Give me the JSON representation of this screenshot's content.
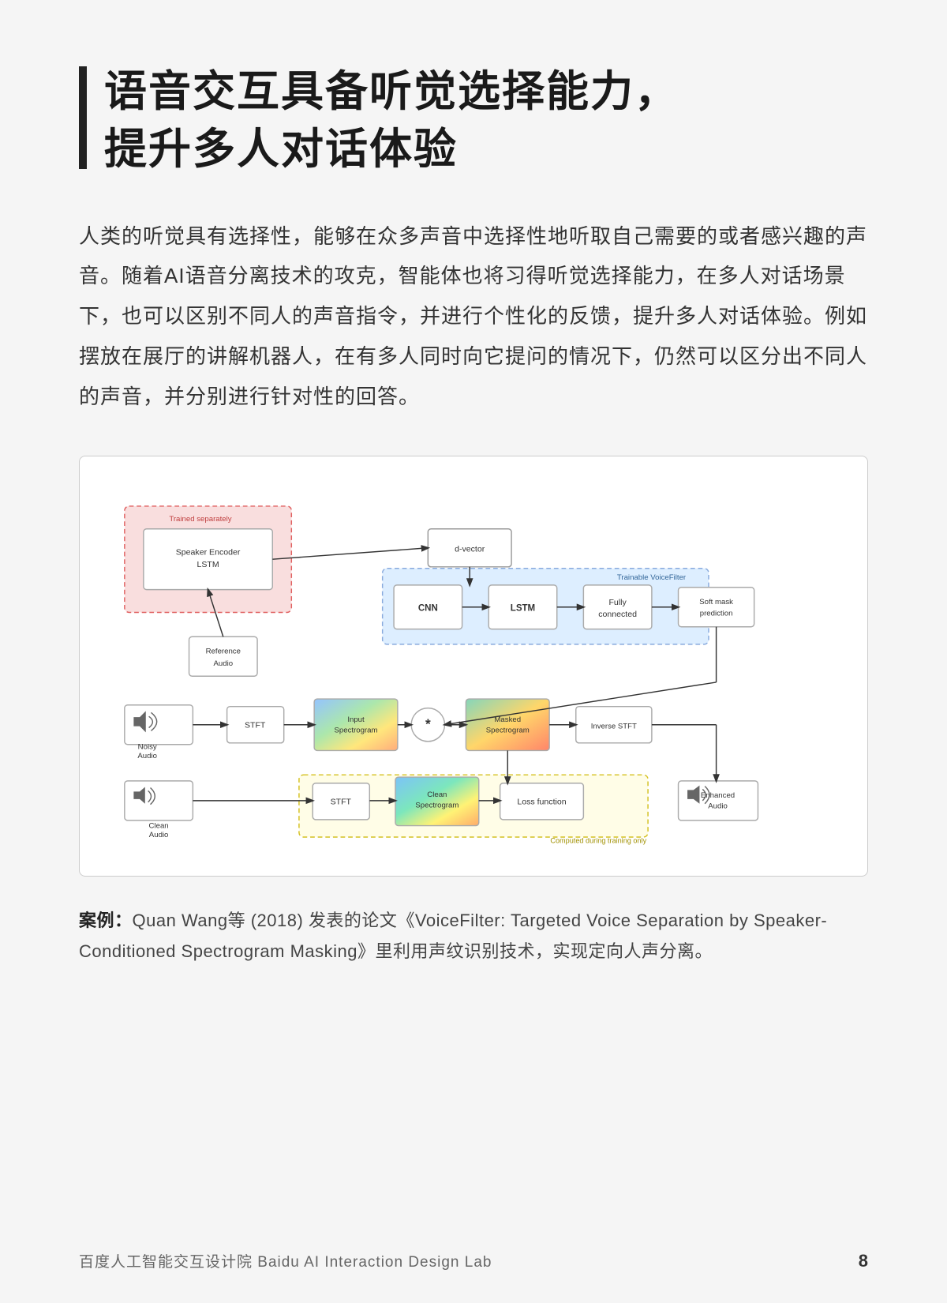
{
  "title": {
    "line1": "语音交互具备听觉选择能力，",
    "line2": "提升多人对话体验"
  },
  "body": "人类的听觉具有选择性，能够在众多声音中选择性地听取自己需要的或者感兴趣的声音。随着AI语音分离技术的攻克，智能体也将习得听觉选择能力，在多人对话场景下，也可以区别不同人的声音指令，并进行个性化的反馈，提升多人对话体验。例如摆放在展厅的讲解机器人，在有多人同时向它提问的情况下，仍然可以区分出不同人的声音，并分别进行针对性的回答。",
  "caption": {
    "label": "案例：",
    "text": "Quan Wang等 (2018) 发表的论文《VoiceFilter: Targeted Voice Separation by Speaker-Conditioned Spectrogram Masking》里利用声纹识别技术，实现定向人声分离。"
  },
  "diagram": {
    "trained_separately": "Trained separately",
    "speaker_encoder": "Speaker Encoder LSTM",
    "d_vector": "d-vector",
    "trainable_vf": "Trainable VoiceFilter",
    "cnn": "CNN",
    "lstm": "LSTM",
    "fully_connected": "Fully connected",
    "soft_mask": "Soft mask prediction",
    "reference_audio": "Reference Audio",
    "noisy_audio": "Noisy Audio",
    "stft1": "STFT",
    "input_spec": "Input Spectrogram",
    "multiply": "*",
    "masked_spec": "Masked Spectrogram",
    "inverse_stft": "Inverse STFT",
    "clean_audio": "Clean Audio",
    "stft2": "STFT",
    "clean_spec": "Clean Spectrogram",
    "loss_fn": "Loss function",
    "enhanced_audio": "Enhanced Audio",
    "computed": "Computed during training only"
  },
  "footer": {
    "left": "百度人工智能交互设计院   Baidu AI Interaction Design Lab",
    "page": "8"
  }
}
